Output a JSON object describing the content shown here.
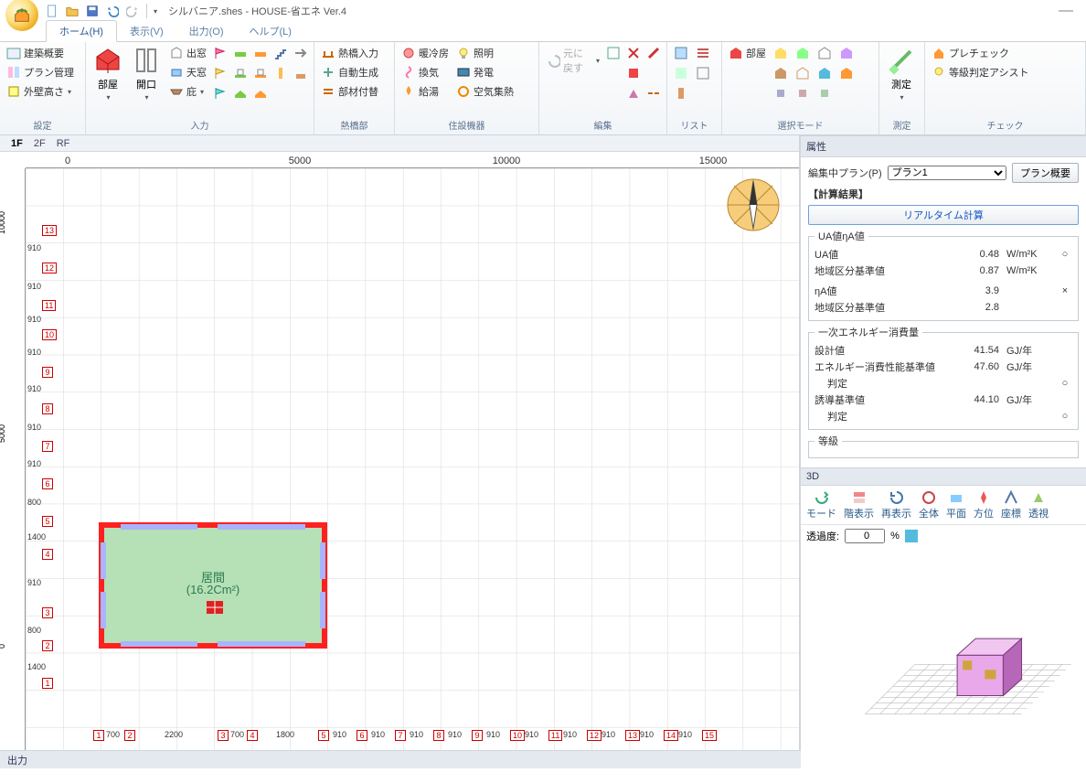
{
  "title": "シルバニア.shes - HOUSE-省エネ Ver.4",
  "qat": {
    "dropdown": "▾"
  },
  "tabs": {
    "home": "ホーム(H)",
    "view": "表示(V)",
    "output": "出力(O)",
    "help": "ヘルプ(L)"
  },
  "ribbon": {
    "settings": {
      "label": "設定",
      "b1": "建築概要",
      "b2": "プラン管理",
      "b3": "外壁高さ"
    },
    "input": {
      "label": "入力",
      "room": "部屋",
      "opening": "開口",
      "r1": "出窓",
      "r2": "天窓",
      "r3": "庇"
    },
    "bridge": {
      "label": "熱橋部",
      "b1": "熱橋入力",
      "b2": "自動生成",
      "b3": "部材付替"
    },
    "equip": {
      "label": "住設機器",
      "b1": "暖冷房",
      "b2": "換気",
      "b3": "給湯",
      "c1": "照明",
      "c2": "発電",
      "c3": "空気集熱"
    },
    "edit": {
      "label": "編集",
      "undo": "元に戻す"
    },
    "list": {
      "label": "リスト"
    },
    "select": {
      "label": "選択モード",
      "room": "部屋"
    },
    "measure": {
      "label": "測定",
      "btn": "測定"
    },
    "check": {
      "label": "チェック",
      "b1": "プレチェック",
      "b2": "等級判定アシスト"
    }
  },
  "floors": {
    "f1": "1F",
    "f2": "2F",
    "rf": "RF"
  },
  "rulerH": {
    "t0": "0",
    "t1": "5000",
    "t2": "10000",
    "t3": "15000"
  },
  "rulerV": {
    "t0": "0",
    "t1": "5000",
    "t2": "10000"
  },
  "gridY": {
    "g1": "1",
    "g2": "2",
    "g3": "3",
    "g4": "4",
    "g5": "5",
    "g6": "6",
    "g7": "7",
    "g8": "8",
    "g9": "9",
    "g10": "10",
    "g11": "11",
    "g12": "12",
    "g13": "13"
  },
  "gridX": {
    "g1": "1",
    "g2": "2",
    "g3": "3",
    "g4": "4",
    "g5": "5",
    "g6": "6",
    "g7": "7",
    "g8": "8",
    "g9": "9",
    "g10": "10",
    "g11": "11",
    "g12": "12",
    "g13": "13",
    "g14": "14",
    "g15": "15"
  },
  "dimsY": {
    "d1": "1400",
    "d2": "800",
    "d3": "910",
    "d4": "1400",
    "d5": "800",
    "d6": "910",
    "d7": "910",
    "d8": "910",
    "d9": "910",
    "d10": "910",
    "d11": "910",
    "d12": "910"
  },
  "dimsX": {
    "d1": "700",
    "d2": "2200",
    "d3": "700",
    "d4": "1800",
    "d5": "910",
    "d6": "910",
    "d7": "910",
    "d8": "910",
    "d9": "910",
    "d10": "910",
    "d11": "910",
    "d12": "910",
    "d13": "910",
    "d14": "910"
  },
  "room": {
    "name": "居間",
    "area": "(16.2Cm²)"
  },
  "props": {
    "panel_title": "属性",
    "plan_label": "編集中プラン(P)",
    "plan_value": "プラン1",
    "plan_summary_btn": "プラン概要",
    "calc_legend": "【計算結果】",
    "realtime_btn": "リアルタイム計算",
    "ua_legend": "UA値ηA値",
    "ua_label": "UA値",
    "ua_val": "0.48",
    "ua_unit": "W/m²K",
    "ua_status": "○",
    "region_label": "地域区分基準値",
    "region_val": "0.87",
    "region_unit": "W/m²K",
    "na_label": "ηA値",
    "na_val": "3.9",
    "na_status": "×",
    "na_region_label": "地域区分基準値",
    "na_region_val": "2.8",
    "energy_legend": "一次エネルギー消費量",
    "design_label": "設計値",
    "design_val": "41.54",
    "gj": "GJ/年",
    "perf_label": "エネルギー消費性能基準値",
    "perf_val": "47.60",
    "judge_label": "判定",
    "judge_status": "○",
    "induce_label": "誘導基準値",
    "induce_val": "44.10",
    "judge2_label": "判定",
    "judge2_status": "○",
    "rank_legend": "等級"
  },
  "three": {
    "panel_title": "3D",
    "mode": "モード",
    "floor": "階表示",
    "redisp": "再表示",
    "all": "全体",
    "plan": "平面",
    "dir": "方位",
    "coord": "座標",
    "persp": "透視",
    "trans_label": "透過度:",
    "trans_val": "0",
    "pct": "%"
  },
  "output_label": "出力"
}
